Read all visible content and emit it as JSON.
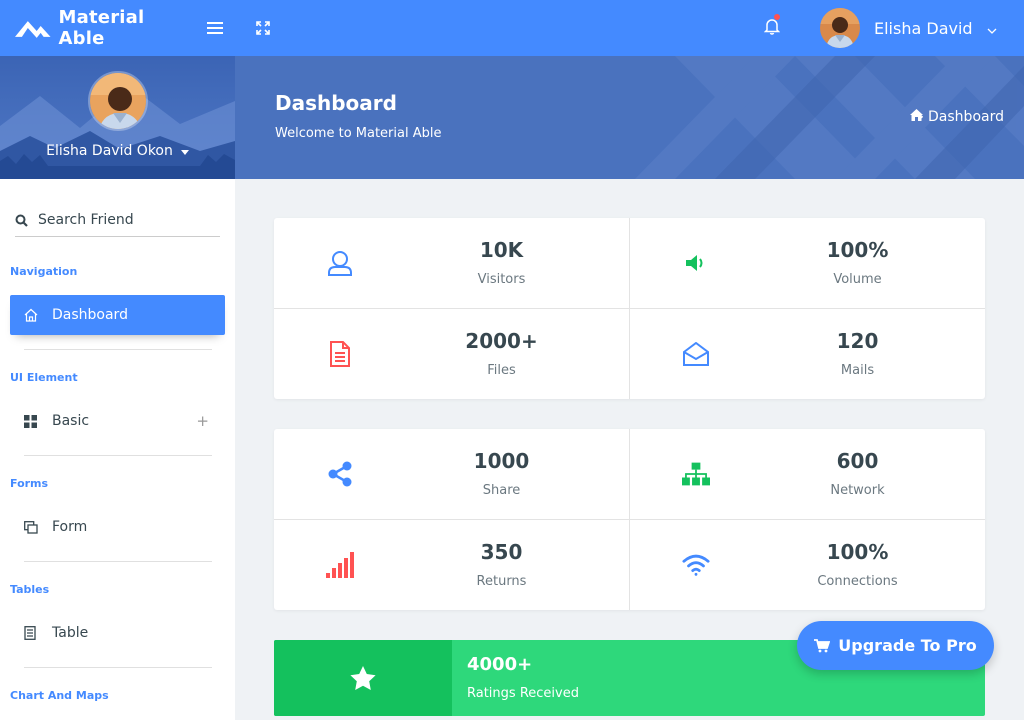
{
  "brand": {
    "name": "Material Able"
  },
  "topbar": {
    "user_name": "Elisha David"
  },
  "sidebar": {
    "user_name": "Elisha David Okon",
    "search_placeholder": "Search Friend",
    "sections": [
      {
        "caption": "Navigation",
        "item": "Dashboard"
      },
      {
        "caption": "UI Element",
        "item": "Basic"
      },
      {
        "caption": "Forms",
        "item": "Form"
      },
      {
        "caption": "Tables",
        "item": "Table"
      },
      {
        "caption": "Chart And Maps"
      }
    ]
  },
  "page": {
    "title": "Dashboard",
    "subtitle": "Welcome to Material Able",
    "breadcrumb": "Dashboard"
  },
  "stats_1": [
    {
      "value": "10K",
      "label": "Visitors",
      "icon": "user-icon",
      "color": "#448aff"
    },
    {
      "value": "100%",
      "label": "Volume",
      "icon": "volume-icon",
      "color": "#14c15d"
    },
    {
      "value": "2000+",
      "label": "Files",
      "icon": "file-icon",
      "color": "#ff5252"
    },
    {
      "value": "120",
      "label": "Mails",
      "icon": "mail-open-icon",
      "color": "#448aff"
    }
  ],
  "stats_2": [
    {
      "value": "1000",
      "label": "Share",
      "icon": "share-icon",
      "color": "#448aff"
    },
    {
      "value": "600",
      "label": "Network",
      "icon": "sitemap-icon",
      "color": "#14c15d"
    },
    {
      "value": "350",
      "label": "Returns",
      "icon": "signal-icon",
      "color": "#ff5252"
    },
    {
      "value": "100%",
      "label": "Connections",
      "icon": "wifi-icon",
      "color": "#448aff"
    }
  ],
  "ratings": {
    "value": "4000+",
    "label": "Ratings Received"
  },
  "upgrade": {
    "label": "Upgrade To Pro"
  }
}
